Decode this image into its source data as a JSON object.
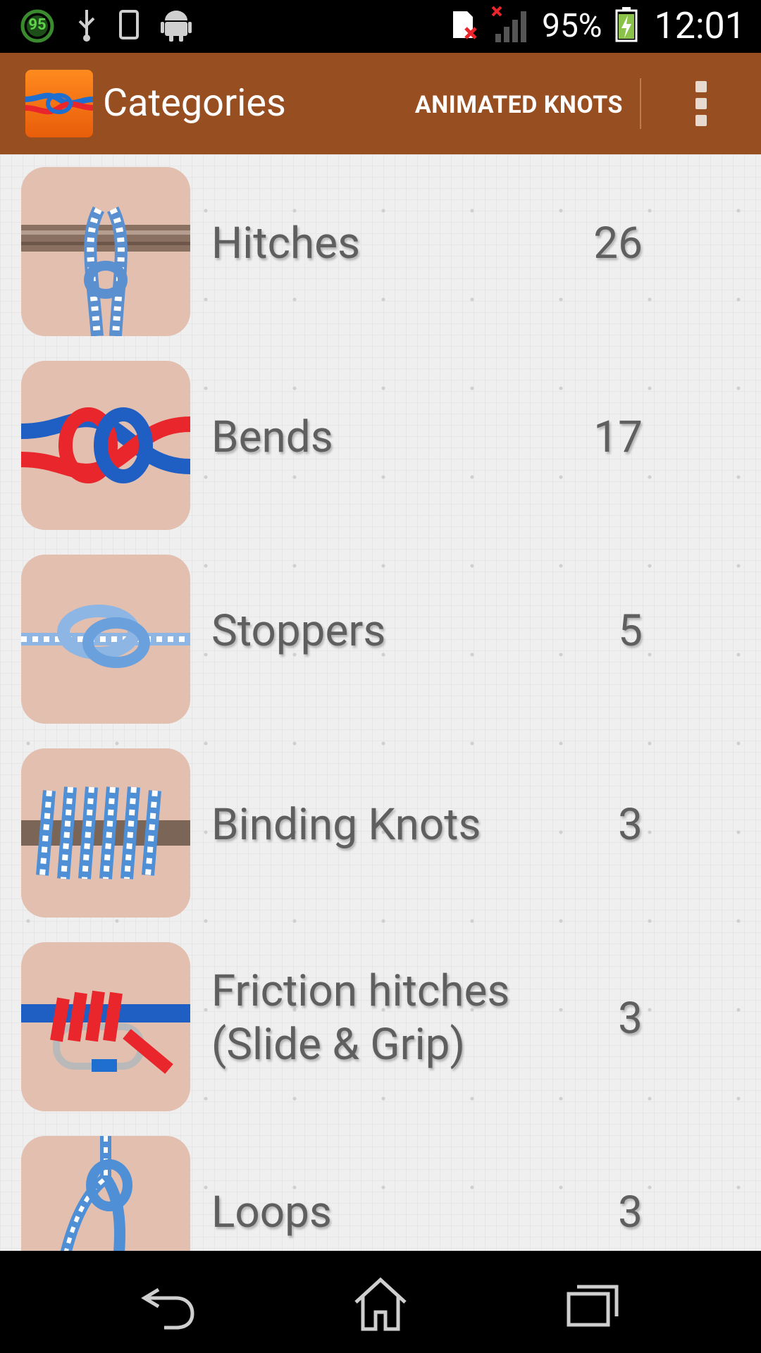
{
  "status_bar": {
    "badge_number": "95",
    "battery_percent": "95%",
    "time": "12:01"
  },
  "action_bar": {
    "title": "Categories",
    "action_label": "ANIMATED KNOTS"
  },
  "categories": [
    {
      "name": "Hitches",
      "count": "26"
    },
    {
      "name": "Bends",
      "count": "17"
    },
    {
      "name": "Stoppers",
      "count": "5"
    },
    {
      "name": "Binding Knots",
      "count": "3"
    },
    {
      "name_line1": "Friction hitches",
      "name_line2": "(Slide & Grip)",
      "count": "3"
    },
    {
      "name": "Loops",
      "count": "3"
    }
  ],
  "colors": {
    "action_bar": "#974e20",
    "text": "#5f5f5f",
    "thumb_bg": "#e3bfb0",
    "rope_blue": "#1f6fd1",
    "rope_red": "#e8262b"
  }
}
